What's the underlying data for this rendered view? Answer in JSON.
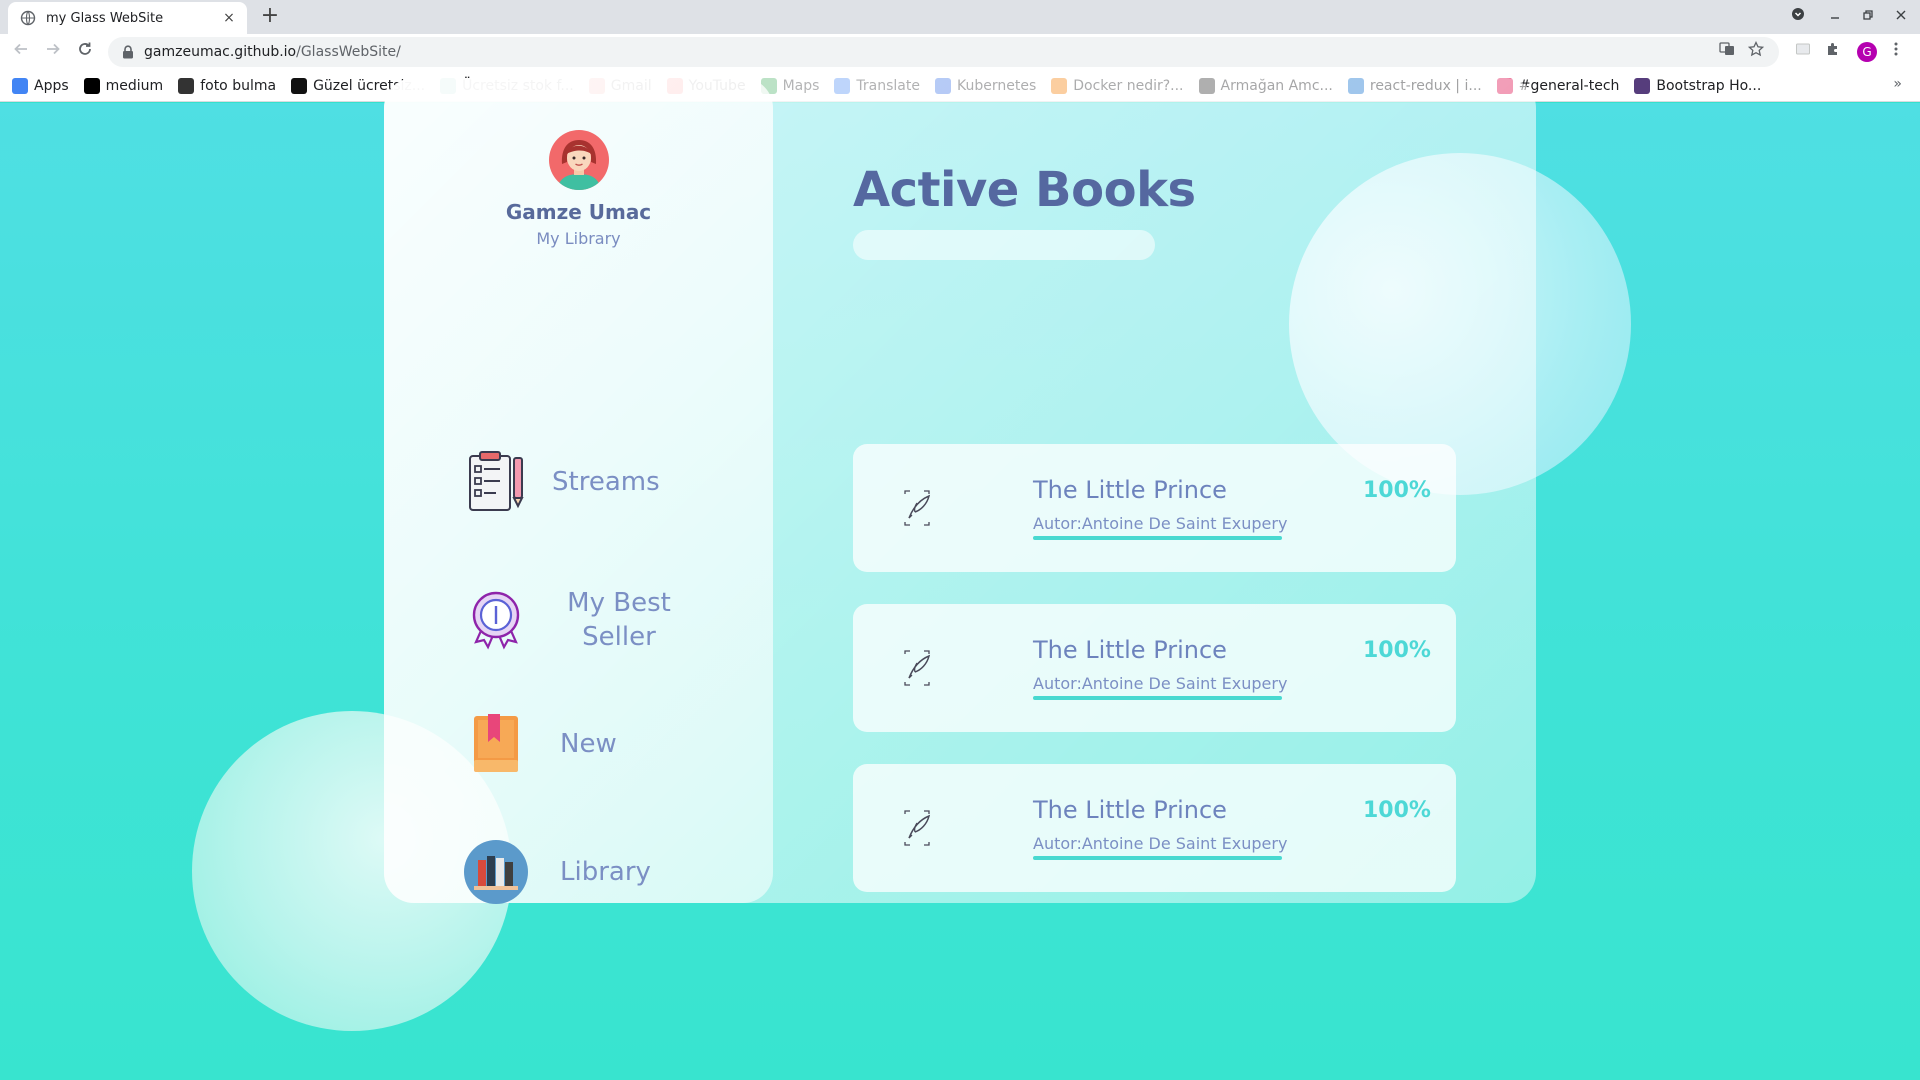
{
  "browser": {
    "tab_title": "my Glass WebSite",
    "tab_close": "×",
    "new_tab": "+",
    "url_host": "gamzeumac.github.io",
    "url_path": "/GlassWebSite/",
    "profile_initial": "G",
    "bookmarks": [
      {
        "label": "Apps",
        "icon": "apps-grid-icon",
        "color": "#4285f4"
      },
      {
        "label": "medium",
        "icon": "medium-icon",
        "color": "#000000"
      },
      {
        "label": "foto bulma",
        "icon": "camera-icon",
        "color": "#333333"
      },
      {
        "label": "Güzel ücretsiz...",
        "icon": "unsplash-icon",
        "color": "#111111"
      },
      {
        "label": "Ücretsiz stok f...",
        "icon": "stock-photo-icon",
        "color": "#05a081"
      },
      {
        "label": "Gmail",
        "icon": "gmail-icon",
        "color": "#ea4335"
      },
      {
        "label": "YouTube",
        "icon": "youtube-icon",
        "color": "#ff0000"
      },
      {
        "label": "Maps",
        "icon": "maps-pin-icon",
        "color": "#34a853"
      },
      {
        "label": "Translate",
        "icon": "translate-icon",
        "color": "#4285f4"
      },
      {
        "label": "Kubernetes",
        "icon": "kubernetes-icon",
        "color": "#326ce5"
      },
      {
        "label": "Docker nedir?...",
        "icon": "docker-icon",
        "color": "#f57c00"
      },
      {
        "label": "Armağan Amc...",
        "icon": "avatar-icon",
        "color": "#333333"
      },
      {
        "label": "react-redux | i...",
        "icon": "react-icon",
        "color": "#1976d2"
      },
      {
        "label": "#general-tech",
        "icon": "slack-icon",
        "color": "#e01e5a"
      },
      {
        "label": "Bootstrap Ho...",
        "icon": "bootstrap-icon",
        "color": "#563d7c"
      }
    ],
    "bookmarks_more": "»"
  },
  "colors": {
    "page_bg": "#35e0cd",
    "title_color": "#5568a0",
    "accent": "#4dd8d6",
    "text_soft": "#7b8fc4"
  },
  "sidebar": {
    "user_name": "Gamze Umac",
    "user_subtitle": "My Library",
    "items": [
      {
        "label": "Streams",
        "icon": "clipboard-checklist-icon"
      },
      {
        "label": "My Best Seller",
        "icon": "award-badge-icon"
      },
      {
        "label": "New",
        "icon": "bookmarked-book-icon"
      },
      {
        "label": "Library",
        "icon": "bookshelf-icon"
      }
    ]
  },
  "main": {
    "title": "Active Books",
    "books": [
      {
        "title": "The Little Prince",
        "author": "Autor:Antoine De Saint Exupery",
        "progress": "100%",
        "progress_value": 1.0
      },
      {
        "title": "The Little Prince",
        "author": "Autor:Antoine De Saint Exupery",
        "progress": "100%",
        "progress_value": 1.0
      },
      {
        "title": "The Little Prince",
        "author": "Autor:Antoine De Saint Exupery",
        "progress": "100%",
        "progress_value": 1.0
      }
    ]
  }
}
